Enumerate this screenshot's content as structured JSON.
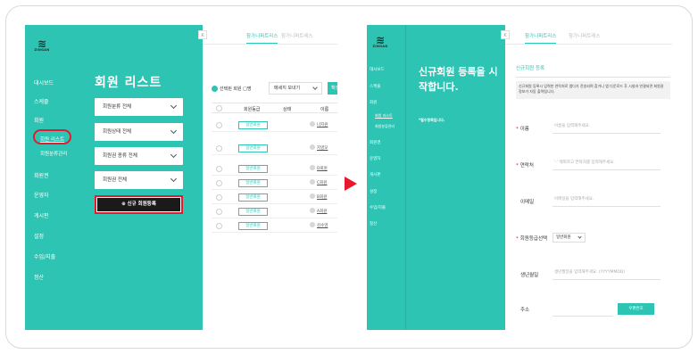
{
  "left_screen": {
    "logo": {
      "word": "ZINGAN"
    },
    "nav": {
      "dashboard": "대시보드",
      "schedule": "스케줄",
      "member": "회원",
      "member_list": "회원 리스트",
      "member_category": "회원분류관리",
      "membership": "회원권",
      "operator": "운영자",
      "board": "게시판",
      "settings": "설정",
      "income": "수입/지출",
      "settlement": "정산"
    },
    "title": "회원 리스트",
    "filters": [
      "회원분류 전체",
      "회원상태 전체",
      "회원권 종류 전체",
      "회원권 전체"
    ],
    "register_button": "⊕ 신규 회원등록",
    "tabs": [
      "참가니퍼트리스",
      "참가니퍼트레스"
    ],
    "toolbar": {
      "selected_label": "선택된 회원",
      "selected_unit": "명",
      "message_select": "메세지 보내기",
      "confirm_button": "확인"
    },
    "table": {
      "headers": [
        "회원등급",
        "상태",
        "이름"
      ],
      "rows": [
        {
          "grade": "일반회원",
          "name": "나지원"
        },
        {
          "grade": "일반회원",
          "name": "지영모"
        },
        {
          "grade": "일반회원",
          "name": "D회원"
        },
        {
          "grade": "일반회원",
          "name": "C회원"
        },
        {
          "grade": "일반회원",
          "name": "B회원"
        },
        {
          "grade": "일반회원",
          "name": "A회원"
        },
        {
          "grade": "일반회원",
          "name": "김수영"
        }
      ]
    }
  },
  "right_screen": {
    "logo": {
      "word": "ZINGAN"
    },
    "nav": {
      "dashboard": "대시보드",
      "schedule": "스케줄",
      "member": "회원",
      "member_list": "회원 리스트",
      "member_category": "회원분류관리",
      "membership": "회원권",
      "operator": "운영자",
      "board": "게시판",
      "settings": "설정",
      "income": "수입/지출",
      "settlement": "정산"
    },
    "heading": "신규회원 등록을 시작합니다.",
    "required_note": "*필수항목입니다.",
    "tabs": [
      "참가니퍼트리스",
      "참가니퍼트레스"
    ],
    "section_title": "신규회원 등록",
    "notice": "신규회원 등록시 입력한 연락처로 앱다가 전송되며 참가니 앱 다운로드 후 시설과 연결되면 회원권 정보가 자동 출력됩니다.",
    "form": {
      "name_label": "이름",
      "name_placeholder": "이름을 입력해주세요.",
      "phone_label": "연락처",
      "phone_placeholder": "'-' 제외하고 연락처를 입력해주세요.",
      "email_label": "이메일",
      "email_placeholder": "이메일을 입력해주세요.",
      "grade_label": "회원등급선택",
      "grade_value": "일반회원",
      "birth_label": "생년월일",
      "birth_placeholder": "생년월일을 입력해주세요. (YYYYMMDD)",
      "address_label": "주소",
      "zip_button": "우편번호"
    }
  },
  "colors": {
    "brand": "#2ec4b3",
    "highlight": "#e8192c",
    "dark": "#1a1a1a"
  }
}
